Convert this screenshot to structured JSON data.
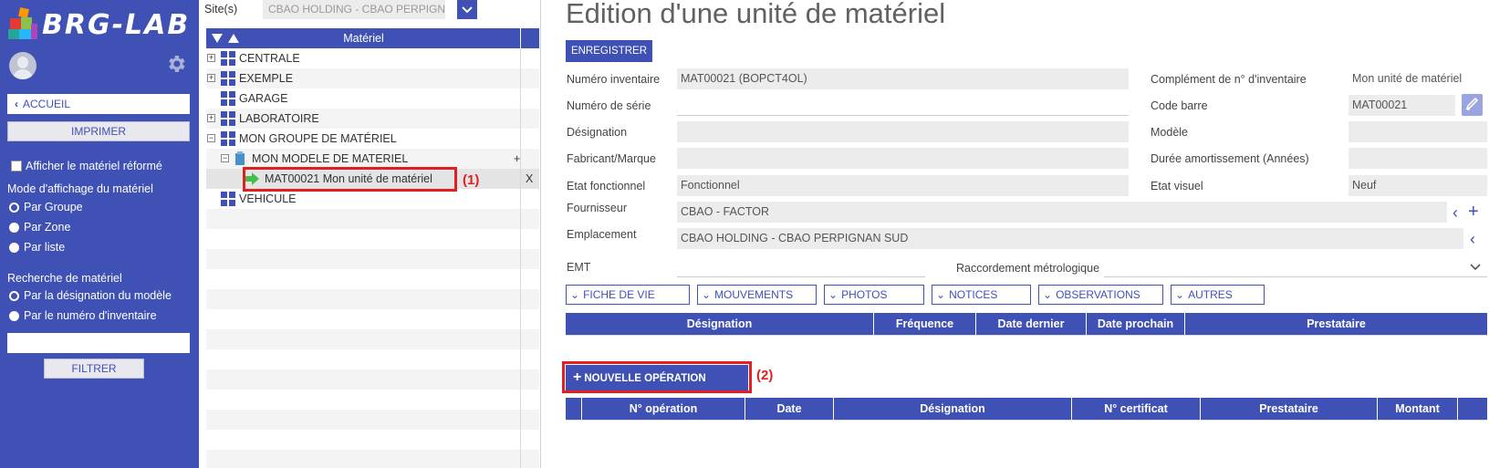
{
  "app": {
    "name": "BRG-LAB",
    "colors": {
      "primary": "#3f51b5",
      "highlight": "#e02020",
      "field_bg": "#ececec"
    }
  },
  "sidebar": {
    "home_label": "ACCUEIL",
    "print_label": "IMPRIMER",
    "show_reformed_label": "Afficher le matériel réformé",
    "display_mode_title": "Mode d'affichage du matériel",
    "display_modes": [
      {
        "label": "Par Groupe",
        "selected": true
      },
      {
        "label": "Par Zone",
        "selected": false
      },
      {
        "label": "Par liste",
        "selected": false
      }
    ],
    "search_title": "Recherche de matériel",
    "search_modes": [
      {
        "label": "Par la désignation du modèle",
        "selected": true
      },
      {
        "label": "Par le numéro d'inventaire",
        "selected": false
      }
    ],
    "search_value": "",
    "filter_label": "FILTRER"
  },
  "tree": {
    "site_label": "Site(s)",
    "site_value": "CBAO HOLDING - CBAO PERPIGN.",
    "header": "Matériel",
    "items": [
      {
        "label": "CENTRALE",
        "expander": "+"
      },
      {
        "label": "EXEMPLE",
        "expander": "+"
      },
      {
        "label": "GARAGE",
        "expander": ""
      },
      {
        "label": "LABORATOIRE",
        "expander": "+"
      },
      {
        "label": "MON GROUPE DE MATÉRIEL",
        "expander": "−"
      },
      {
        "label": "MON MODELE DE MATERIEL",
        "expander": "−",
        "action": "+"
      },
      {
        "label": "MAT00021 Mon unité de matériel",
        "expander": "",
        "action": "X"
      },
      {
        "label": "VEHICULE",
        "expander": ""
      }
    ],
    "annotation_1": "(1)"
  },
  "form": {
    "title": "Edition d'une unité de matériel",
    "save_label": "ENREGISTRER",
    "fields": {
      "inventory_number": {
        "label": "Numéro inventaire",
        "value": "MAT00021 (BOPCT4OL)"
      },
      "serial_number": {
        "label": "Numéro de série",
        "value": ""
      },
      "designation": {
        "label": "Désignation",
        "value": ""
      },
      "manufacturer": {
        "label": "Fabricant/Marque",
        "value": ""
      },
      "functional_state": {
        "label": "Etat fonctionnel",
        "value": "Fonctionnel"
      },
      "supplier": {
        "label": "Fournisseur",
        "value": "CBAO - FACTOR"
      },
      "location": {
        "label": "Emplacement",
        "value": "CBAO HOLDING - CBAO PERPIGNAN SUD"
      },
      "emt": {
        "label": "EMT",
        "value": ""
      },
      "metrology": {
        "label": "Raccordement métrologique",
        "value": ""
      },
      "inventory_complement": {
        "label": "Complément de n° d'inventaire",
        "value": "Mon unité de matériel"
      },
      "barcode": {
        "label": "Code barre",
        "value": "MAT00021"
      },
      "model": {
        "label": "Modèle",
        "value": ""
      },
      "depreciation": {
        "label": "Durée amortissement (Années)",
        "value": ""
      },
      "visual_state": {
        "label": "Etat visuel",
        "value": "Neuf"
      }
    },
    "tabs": [
      "FICHE DE VIE",
      "MOUVEMENTS",
      "PHOTOS",
      "NOTICES",
      "OBSERVATIONS",
      "AUTRES"
    ],
    "schedule_columns": [
      "Désignation",
      "Fréquence",
      "Date dernier",
      "Date prochain",
      "Prestataire"
    ],
    "new_operation_label": "NOUVELLE OPÉRATION",
    "annotation_2": "(2)",
    "operations_columns": [
      "N° opération",
      "Date",
      "Désignation",
      "N° certificat",
      "Prestataire",
      "Montant"
    ]
  }
}
